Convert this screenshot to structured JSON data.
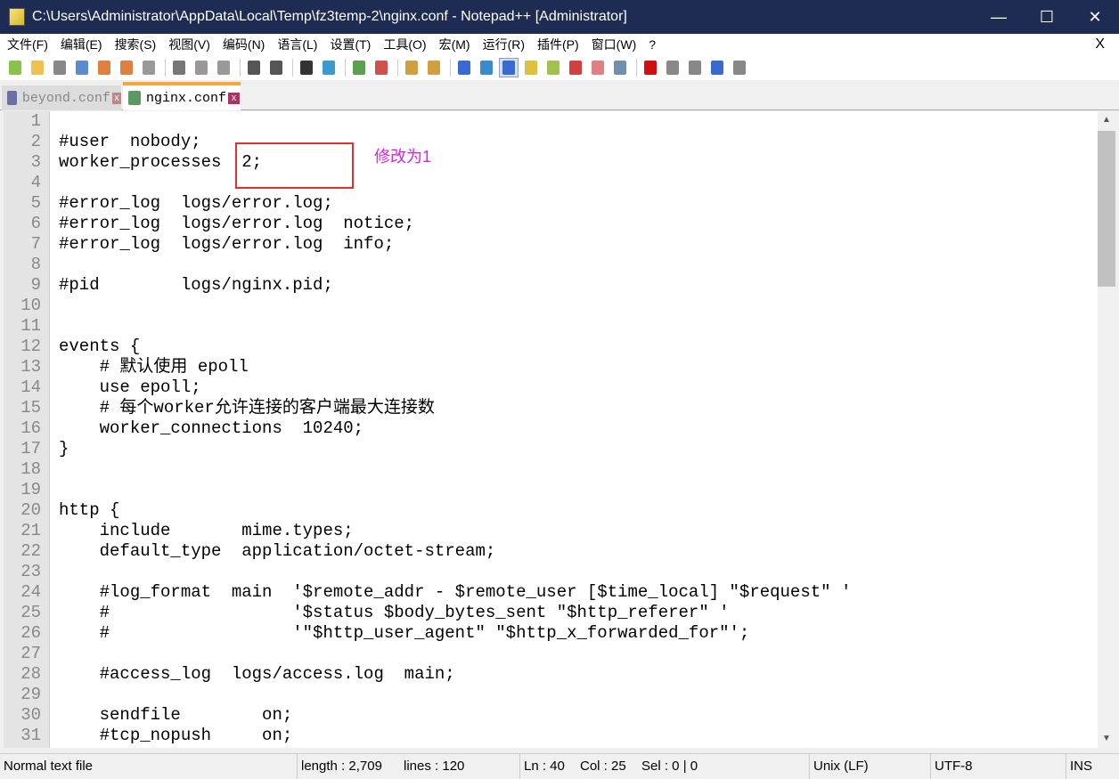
{
  "window": {
    "title": "C:\\Users\\Administrator\\AppData\\Local\\Temp\\fz3temp-2\\nginx.conf - Notepad++ [Administrator]",
    "minimize": "—",
    "maximize": "☐",
    "close": "✕"
  },
  "menu": [
    "文件(F)",
    "编辑(E)",
    "搜索(S)",
    "视图(V)",
    "编码(N)",
    "语言(L)",
    "设置(T)",
    "工具(O)",
    "宏(M)",
    "运行(R)",
    "插件(P)",
    "窗口(W)",
    "?"
  ],
  "menu_close": "X",
  "toolbar": [
    {
      "icon": "new-file-icon",
      "color": "#8bc34a"
    },
    {
      "icon": "open-file-icon",
      "color": "#f0c050"
    },
    {
      "icon": "save-icon",
      "color": "#888"
    },
    {
      "icon": "save-all-icon",
      "color": "#5a8ad0"
    },
    {
      "icon": "close-icon",
      "color": "#e08040"
    },
    {
      "icon": "close-all-icon",
      "color": "#e08040"
    },
    {
      "icon": "print-icon",
      "color": "#999"
    },
    {
      "icon": "cut-icon",
      "color": "#777"
    },
    {
      "icon": "copy-icon",
      "color": "#999"
    },
    {
      "icon": "paste-icon",
      "color": "#999"
    },
    {
      "icon": "undo-icon",
      "color": "#555"
    },
    {
      "icon": "redo-icon",
      "color": "#555"
    },
    {
      "icon": "find-icon",
      "color": "#333"
    },
    {
      "icon": "replace-icon",
      "color": "#3a9ad0"
    },
    {
      "icon": "zoom-in-icon",
      "color": "#5aa050"
    },
    {
      "icon": "zoom-out-icon",
      "color": "#d05050"
    },
    {
      "icon": "sync-vertical-icon",
      "color": "#d0a040"
    },
    {
      "icon": "sync-horizontal-icon",
      "color": "#d0a040"
    },
    {
      "icon": "word-wrap-icon",
      "color": "#3a6ad0"
    },
    {
      "icon": "show-all-chars-icon",
      "color": "#3a8ad0"
    },
    {
      "icon": "indent-guide-icon",
      "color": "#3a6ad0"
    },
    {
      "icon": "language-icon",
      "color": "#e0c040"
    },
    {
      "icon": "doc-map-icon",
      "color": "#a0c050"
    },
    {
      "icon": "function-list-icon",
      "color": "#d04040"
    },
    {
      "icon": "folder-workspace-icon",
      "color": "#e08080"
    },
    {
      "icon": "monitor-icon",
      "color": "#7090b0"
    },
    {
      "icon": "record-macro-icon",
      "color": "#d01010"
    },
    {
      "icon": "stop-macro-icon",
      "color": "#888"
    },
    {
      "icon": "play-macro-icon",
      "color": "#888"
    },
    {
      "icon": "play-multiple-macro-icon",
      "color": "#3a6ad0"
    },
    {
      "icon": "save-macro-icon",
      "color": "#888"
    }
  ],
  "tabs": [
    {
      "label": "beyond.conf",
      "active": false
    },
    {
      "label": "nginx.conf",
      "active": true
    }
  ],
  "tab_close": "x",
  "lines": [
    "",
    "#user  nobody;",
    "worker_processes  2;",
    "",
    "#error_log  logs/error.log;",
    "#error_log  logs/error.log  notice;",
    "#error_log  logs/error.log  info;",
    "",
    "#pid        logs/nginx.pid;",
    "",
    "",
    "events {",
    "    # 默认使用 epoll",
    "    use epoll;",
    "    # 每个worker允许连接的客户端最大连接数",
    "    worker_connections  10240;",
    "}",
    "",
    "",
    "http {",
    "    include       mime.types;",
    "    default_type  application/octet-stream;",
    "",
    "    #log_format  main  '$remote_addr - $remote_user [$time_local] \"$request\" '",
    "    #                  '$status $body_bytes_sent \"$http_referer\" '",
    "    #                  '\"$http_user_agent\" \"$http_x_forwarded_for\"';",
    "",
    "    #access_log  logs/access.log  main;",
    "",
    "    sendfile        on;",
    "    #tcp_nopush     on;"
  ],
  "annotation": "修改为1",
  "status": {
    "file_type": "Normal text file",
    "length": "length : 2,709",
    "lines": "lines : 120",
    "ln": "Ln : 40",
    "col": "Col : 25",
    "sel": "Sel : 0 | 0",
    "eol": "Unix (LF)",
    "encoding": "UTF-8",
    "mode": "INS"
  },
  "colors": {
    "titlebar": "#1e2b52",
    "annotation": "#e020e0",
    "highlight_box": "#e03030",
    "active_tab_accent": "#f7a73c"
  }
}
